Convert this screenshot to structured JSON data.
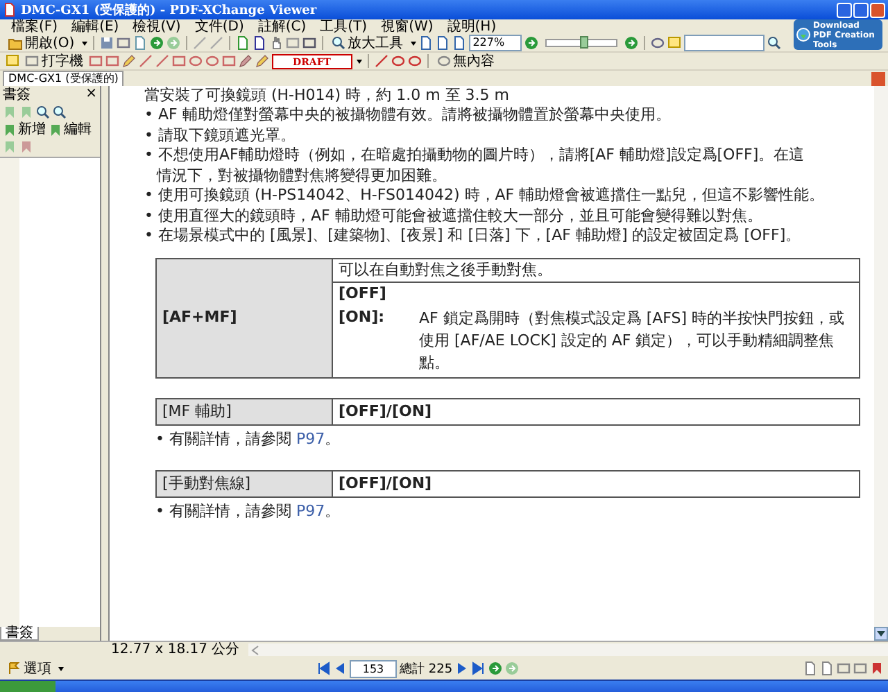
{
  "window": {
    "title": "DMC-GX1 (受保護的) - PDF-XChange Viewer"
  },
  "menu": [
    "檔案(F)",
    "編輯(E)",
    "檢視(V)",
    "文件(D)",
    "註解(C)",
    "工具(T)",
    "視窗(W)",
    "說明(H)"
  ],
  "promo": {
    "label": "Download PDF Creation Tools"
  },
  "toolbar": {
    "open_button": "開啟(O)",
    "zoom_tool": "放大工具",
    "zoom_value": "227%",
    "zoom_slider": {
      "level": 0.55
    },
    "typewriter": "打字機",
    "stamp": "DRAFT",
    "no_content": "無內容"
  },
  "document_tab": {
    "title": "DMC-GX1 (受保護的)"
  },
  "bookmarks_panel": {
    "title": "書簽",
    "close": "×",
    "buttons": [
      "新增",
      "編輯"
    ],
    "tab": "書簽"
  },
  "page": {
    "cut_line": "當安裝了可換鏡頭 (H-H014) 時，約 1.0 m 至 3.5 m",
    "bullets": [
      {
        "lines": [
          "• AF 輔助燈僅對螢幕中央的被攝物體有效。請將被攝物體置於螢幕中央使用。"
        ]
      },
      {
        "lines": [
          "• 請取下鏡頭遮光罩。"
        ]
      },
      {
        "lines": [
          "• 不想使用AF輔助燈時（例如，在暗處拍攝動物的圖片時），請將[AF 輔助燈]設定爲[OFF]。在這",
          "情況下，對被攝物體對焦將變得更加困難。"
        ]
      },
      {
        "lines": [
          "• 使用可換鏡頭 (H-PS14042、H-FS014042) 時，AF 輔助燈會被遮擋住一點兒，但這不影響性能。"
        ]
      },
      {
        "lines": [
          "• 使用直徑大的鏡頭時，AF 輔助燈可能會被遮擋住較大一部分，並且可能會變得難以對焦。"
        ]
      },
      {
        "lines": [
          "• 在場景模式中的 [風景]、[建築物]、[夜景] 和 [日落] 下，[AF 輔助燈] 的設定被固定爲 [OFF]。"
        ]
      }
    ],
    "blocks": [
      {
        "kind": "detail_table",
        "label": "[AF+MF]",
        "summary": "可以在自動對焦之後手動對焦。",
        "options": [
          {
            "key": "[OFF]"
          },
          {
            "key": "[ON]:",
            "text": "AF 鎖定爲開時（對焦模式設定爲 [AFS] 時的半按快門按鈕，或使用 [AF/AE LOCK] 設定的 AF 鎖定），可以手動精細調整焦點。"
          }
        ]
      },
      {
        "kind": "setting",
        "label": "[MF 輔助]",
        "value": "[OFF]/[ON]"
      },
      {
        "kind": "note",
        "text": "• 有關詳情，請參閱 ",
        "link": "P97",
        "after": "。"
      },
      {
        "kind": "setting",
        "label": "[手動對焦線]",
        "value": "[OFF]/[ON]"
      },
      {
        "kind": "note",
        "text": "• 有關詳情，請參閱 ",
        "link": "P97",
        "after": "。"
      }
    ]
  },
  "status": {
    "page_size": "12.77 x 18.17 公分"
  },
  "bottom_bar": {
    "options_button": "選項",
    "page_number": "153",
    "page_total": "總計 225"
  }
}
